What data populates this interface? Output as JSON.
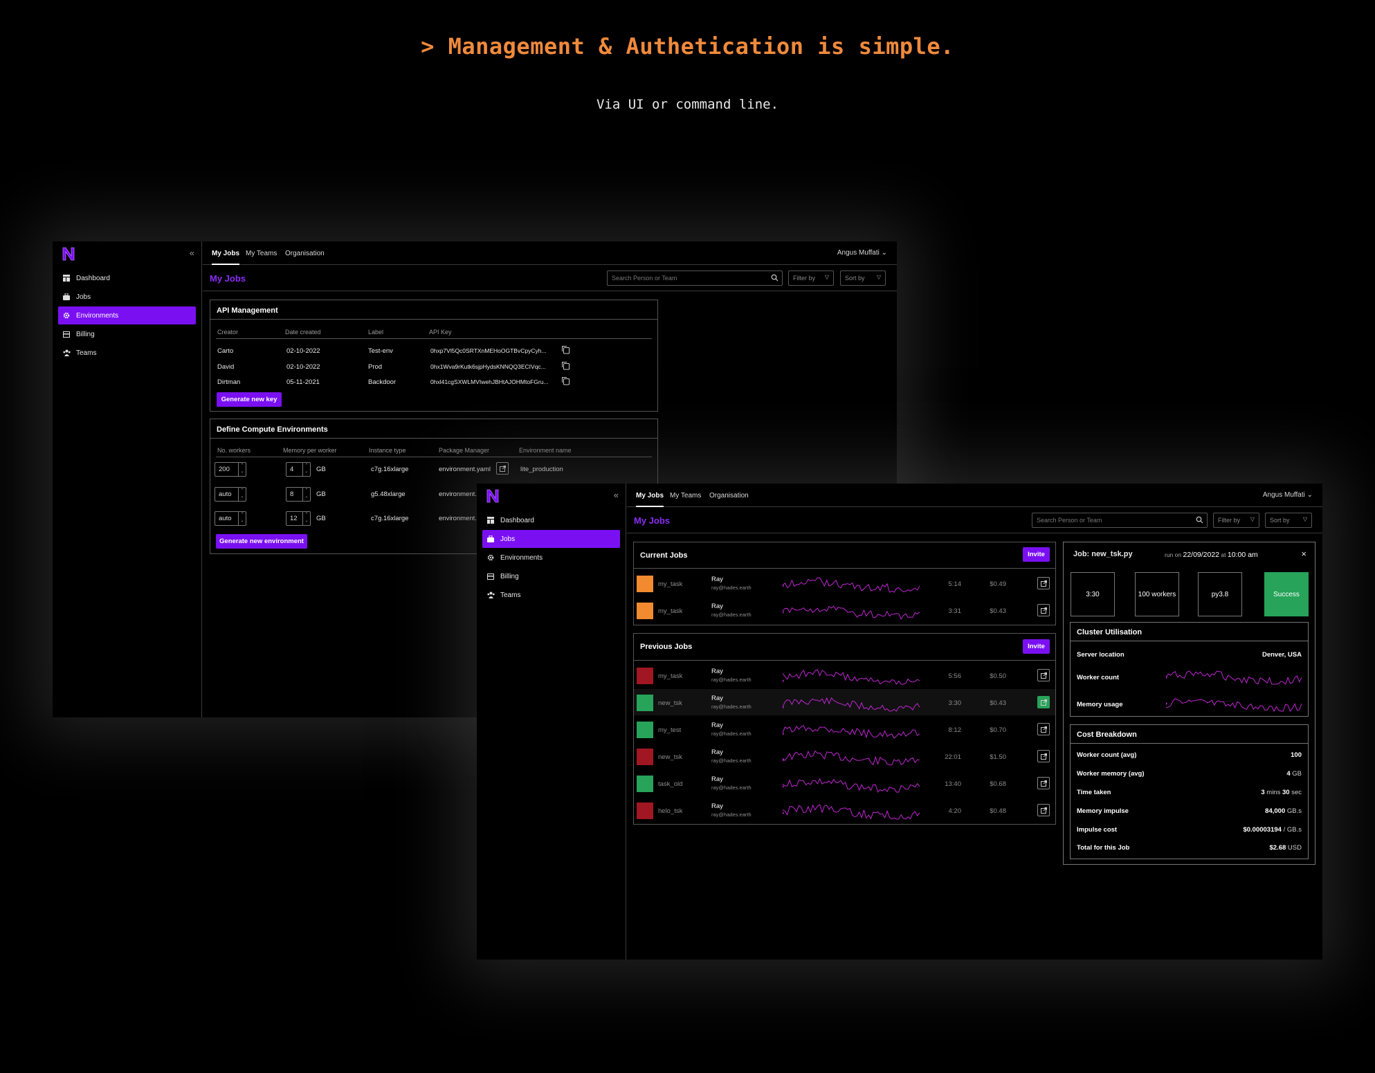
{
  "hero": {
    "title": "> Management & Authetication is simple.",
    "subtitle": "Via UI or command line."
  },
  "colors": {
    "accent": "#7a10f2",
    "hero": "#f08a3c",
    "orange": "#f28a30",
    "red": "#a01622",
    "green": "#27a35a",
    "spark": "#c026d3"
  },
  "nav": {
    "items": [
      {
        "label": "Dashboard",
        "icon": "dashboard-icon"
      },
      {
        "label": "Jobs",
        "icon": "jobs-icon"
      },
      {
        "label": "Environments",
        "icon": "gear-icon"
      },
      {
        "label": "Billing",
        "icon": "billing-icon"
      },
      {
        "label": "Teams",
        "icon": "teams-icon"
      }
    ]
  },
  "topnav": {
    "tabs": [
      "My Jobs",
      "My Teams",
      "Organisation"
    ],
    "user": "Angus Muffati"
  },
  "toolbar": {
    "page_title": "My Jobs",
    "search_placeholder": "Search Person or Team",
    "filter": "Filter by",
    "sort": "Sort by"
  },
  "api": {
    "title": "API Management",
    "headers": [
      "Creator",
      "Date created",
      "Label",
      "API Key"
    ],
    "rows": [
      {
        "creator": "Carto",
        "date": "02-10-2022",
        "label": "Test-env",
        "key": "0hxp7Vl5Qc0SRTXnMEHoOGTBvCpyCyh..."
      },
      {
        "creator": "David",
        "date": "02-10-2022",
        "label": "Prod",
        "key": "0hx1Wva9rKutk6sjpHydsKNNQQ3ECIVqc..."
      },
      {
        "creator": "Dirtman",
        "date": "05-11-2021",
        "label": "Backdoor",
        "key": "0hxl41cgSXWLMVIwehJBHtAJOHMtoFGru..."
      }
    ],
    "button": "Generate new key"
  },
  "compute": {
    "title": "Define Compute Environments",
    "headers": [
      "No. workers",
      "Memory per worker",
      "Instance type",
      "Package Manager",
      "Environment name"
    ],
    "unit": "GB",
    "rows": [
      {
        "workers": "200",
        "memory": "4",
        "instance": "c7g.16xlarge",
        "pkg": "environment.yaml",
        "env": "lite_production"
      },
      {
        "workers": "auto",
        "memory": "8",
        "instance": "g5.48xlarge",
        "pkg": "environment.",
        "env": ""
      },
      {
        "workers": "auto",
        "memory": "12",
        "instance": "c7g.16xlarge",
        "pkg": "environment.",
        "env": ""
      }
    ],
    "button": "Generate new environment"
  },
  "current_jobs": {
    "title": "Current Jobs",
    "invite": "Invite",
    "rows": [
      {
        "name": "my_task",
        "user": "Ray",
        "email": "ray@hades.earth",
        "time": "5:14",
        "cost": "$0.49",
        "status": "orange"
      },
      {
        "name": "my_task",
        "user": "Ray",
        "email": "ray@hades.earth",
        "time": "3:31",
        "cost": "$0.43",
        "status": "orange"
      }
    ]
  },
  "previous_jobs": {
    "title": "Previous Jobs",
    "invite": "Invite",
    "rows": [
      {
        "name": "my_task",
        "user": "Ray",
        "email": "ray@hades.earth",
        "time": "5:56",
        "cost": "$0.50",
        "status": "red"
      },
      {
        "name": "new_tsk",
        "user": "Ray",
        "email": "ray@hades.earth",
        "time": "3:30",
        "cost": "$0.43",
        "status": "green"
      },
      {
        "name": "my_test",
        "user": "Ray",
        "email": "ray@hades.earth",
        "time": "8:12",
        "cost": "$0.70",
        "status": "green"
      },
      {
        "name": "new_tsk",
        "user": "Ray",
        "email": "ray@hades.earth",
        "time": "22:01",
        "cost": "$1.50",
        "status": "red"
      },
      {
        "name": "task_old",
        "user": "Ray",
        "email": "ray@hades.earth",
        "time": "13:40",
        "cost": "$0.68",
        "status": "green"
      },
      {
        "name": "helo_tsk",
        "user": "Ray",
        "email": "ray@hades.earth",
        "time": "4:20",
        "cost": "$0.48",
        "status": "red"
      }
    ]
  },
  "job_detail": {
    "title": "Job: new_tsk.py",
    "run_on_prefix": "run on",
    "run_date": "22/09/2022",
    "at": "at",
    "run_time": "10:00 am",
    "close": "×",
    "stats": [
      "3:30",
      "100 workers",
      "py3.8",
      "Success"
    ],
    "cluster": {
      "title": "Cluster Utilisation",
      "server_label": "Server location",
      "server_value": "Denver, USA",
      "worker_label": "Worker count",
      "memory_label": "Memory usage"
    },
    "cost": {
      "title": "Cost Breakdown",
      "rows": [
        {
          "label": "Worker count (avg)",
          "value": "100",
          "unit": ""
        },
        {
          "label": "Worker memory (avg)",
          "value": "4",
          "unit": " GB"
        },
        {
          "label": "Time taken",
          "value": "3",
          "unit": " mins ",
          "value2": "30",
          "unit2": " sec"
        },
        {
          "label": "Memory impulse",
          "value": "84,000",
          "unit": " GB.s"
        },
        {
          "label": "Impulse cost",
          "value": "$0.00003194",
          "unit": " / GB.s"
        },
        {
          "label": "Total for this Job",
          "value": "$2.68",
          "unit": " USD"
        }
      ]
    }
  }
}
